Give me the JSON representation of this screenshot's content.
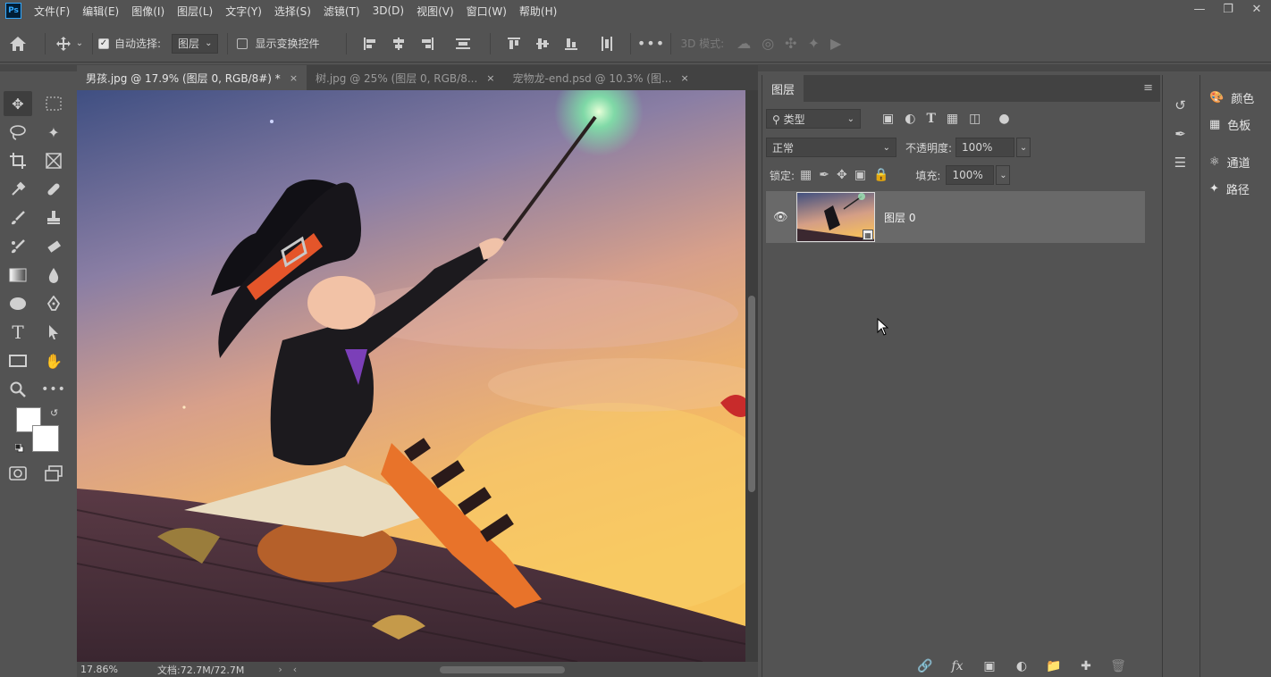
{
  "app": {
    "logo": "Ps"
  },
  "menu": [
    "文件(F)",
    "编辑(E)",
    "图像(I)",
    "图层(L)",
    "文字(Y)",
    "选择(S)",
    "滤镜(T)",
    "3D(D)",
    "视图(V)",
    "窗口(W)",
    "帮助(H)"
  ],
  "options": {
    "auto_select_label": "自动选择:",
    "auto_select_value": "图层",
    "show_transform_label": "显示变换控件",
    "mode_3d_label": "3D 模式:"
  },
  "tabs": [
    {
      "label": "男孩.jpg @ 17.9% (图层 0, RGB/8#) *",
      "close": "×"
    },
    {
      "label": "树.jpg @ 25% (图层 0, RGB/8...",
      "close": "×"
    },
    {
      "label": "宠物龙-end.psd @ 10.3% (图...",
      "close": "×"
    }
  ],
  "status": {
    "zoom": "17.86%",
    "doc": "文档:72.7M/72.7M"
  },
  "layers": {
    "tab": "图层",
    "filter_label": "类型",
    "blend_mode": "正常",
    "opacity_label": "不透明度:",
    "opacity_value": "100%",
    "lock_label": "锁定:",
    "fill_label": "填充:",
    "fill_value": "100%",
    "items": [
      {
        "name": "图层 0",
        "visible": true
      }
    ]
  },
  "dock": {
    "items": [
      {
        "label": "颜色",
        "icon": "palette-icon"
      },
      {
        "label": "色板",
        "icon": "swatches-icon"
      },
      {
        "label": "通道",
        "icon": "channels-icon"
      },
      {
        "label": "路径",
        "icon": "paths-icon"
      }
    ]
  },
  "colors": {
    "ui_bg": "#535353",
    "dark": "#424242",
    "accent": "#31a8ff"
  }
}
